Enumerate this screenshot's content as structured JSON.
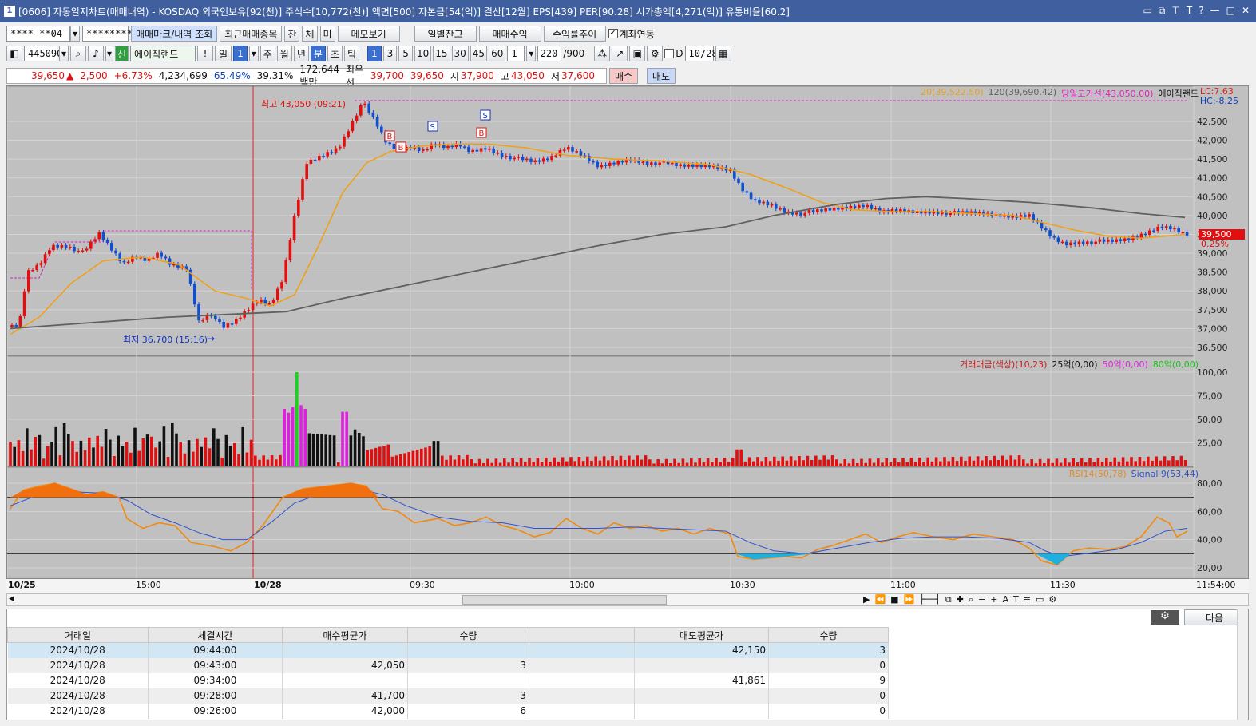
{
  "window": {
    "title": "[0606] 자동일지차트(매매내역) - KOSDAQ 외국인보유[92(천)] 주식수[10,772(천)] 액면[500] 자본금[54(억)] 결산[12월] EPS[439] PER[90.28] 시가총액[4,271(억)] 유통비율[60.2]",
    "icon": "1"
  },
  "toolbar1": {
    "account": "****-**04",
    "password": "*********",
    "mark_btn": "매매마크/내역 조회",
    "recent_btn": "최근매매종목",
    "jan": "잔",
    "che": "체",
    "mi": "미",
    "memo_btn": "메모보기",
    "daily_btn": "일별잔고",
    "profit_btn": "매매수익",
    "trend_btn": "수익률추이",
    "link_label": "계좌연동"
  },
  "toolbar2": {
    "code": "445090",
    "credit": "신",
    "stock_name": "에이직랜드",
    "periods": [
      "일",
      "1",
      "주",
      "월",
      "년",
      "분",
      "초",
      "틱"
    ],
    "minutes": [
      "1",
      "3",
      "5",
      "10",
      "15",
      "30",
      "45",
      "60"
    ],
    "unit": "1",
    "count": "220",
    "count_total": "/900",
    "d_label": "D",
    "date": "10/28"
  },
  "quote": {
    "price": "39,650",
    "arrow": "▲",
    "change": "2,500",
    "pct": "+6.73%",
    "volume": "4,234,699",
    "vol_pct": "65.49%",
    "ratio": "39.31%",
    "amount": "172,644백만",
    "best_label": "최우선",
    "best_bid": "39,700",
    "best_ask": "39,650",
    "open_label": "시",
    "open": "37,900",
    "high_label": "고",
    "high": "43,050",
    "low_label": "저",
    "low": "37,600",
    "buy_btn": "매수",
    "sell_btn": "매도"
  },
  "chart": {
    "legend_price": [
      {
        "text": "20(39,522.50)",
        "color": "#e8a020"
      },
      {
        "text": "120(39,690.42)",
        "color": "#606060"
      },
      {
        "text": "당일고가선(43,050.00)",
        "color": "#e020c0"
      },
      {
        "text": "에이직랜드",
        "color": "#111111"
      }
    ],
    "lc": "LC:7.63",
    "hc": "HC:-8.25",
    "high_label": "최고 43,050 (09:21)",
    "low_label": "최저 36,700 (15:16)",
    "price_ticks": [
      "42,500",
      "42,000",
      "41,500",
      "41,000",
      "40,500",
      "40,000",
      "39,500",
      "39,000",
      "38,500",
      "38,000",
      "37,500",
      "37,000",
      "36,500"
    ],
    "cur_price": "39,500",
    "cur_pct": "0.25%",
    "vol_legend": [
      {
        "text": "거래대금(색상)(10,23)",
        "color": "#c02020"
      },
      {
        "text": "25억(0,00)",
        "color": "#111111"
      },
      {
        "text": "50억(0,00)",
        "color": "#e020e0"
      },
      {
        "text": "80억(0,00)",
        "color": "#20c020"
      }
    ],
    "vol_ticks": [
      "100,00",
      "75,00",
      "50,00",
      "25,00"
    ],
    "rsi_legend": [
      {
        "text": "RSI14(50,78)",
        "color": "#e08a20"
      },
      {
        "text": "Signal 9(53,44)",
        "color": "#3050d0"
      }
    ],
    "rsi_ticks": [
      "80,00",
      "60,00",
      "40,00",
      "20,00"
    ],
    "time_labels": [
      "10/25",
      "15:00",
      "10/28",
      "09:30",
      "10:00",
      "10:30",
      "11:00",
      "11:30",
      "11:54:00"
    ],
    "markers": [
      "B",
      "B",
      "S",
      "B",
      "S"
    ]
  },
  "bottom": {
    "next_btn": "다음",
    "settings_icon": "gear-icon"
  },
  "table": {
    "headers": [
      "거래일",
      "체결시간",
      "매수평균가",
      "수량",
      "",
      "매도평균가",
      "수량"
    ],
    "rows": [
      [
        "2024/10/28",
        "09:44:00",
        "",
        "",
        "",
        "42,150",
        "3"
      ],
      [
        "2024/10/28",
        "09:43:00",
        "42,050",
        "3",
        "",
        "",
        "0"
      ],
      [
        "2024/10/28",
        "09:34:00",
        "",
        "",
        "",
        "41,861",
        "9"
      ],
      [
        "2024/10/28",
        "09:28:00",
        "41,700",
        "3",
        "",
        "",
        "0"
      ],
      [
        "2024/10/28",
        "09:26:00",
        "42,000",
        "6",
        "",
        "",
        "0"
      ]
    ]
  }
}
